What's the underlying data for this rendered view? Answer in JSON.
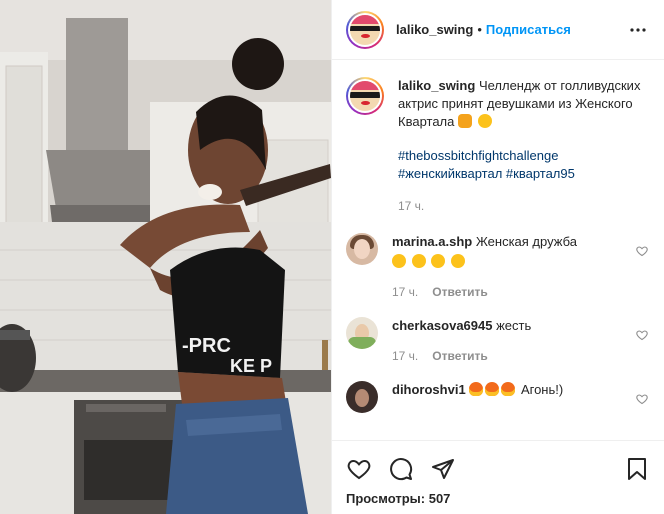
{
  "post": {
    "author": "laliko_swing",
    "separator": "•",
    "follow_label": "Подписаться",
    "more_icon": "more-horizontal-icon"
  },
  "caption": {
    "author": "laliko_swing",
    "text": "Челлендж от голливудских актрис принят девушками из Женского Квартала",
    "hashtags": [
      "#thebossbitchfightchallenge",
      "#женскийквартал",
      "#квартал95"
    ],
    "time": "17 ч."
  },
  "comments": [
    {
      "user": "marina.a.shp",
      "text": "Женская дружба",
      "time": "17 ч.",
      "reply_label": "Ответить"
    },
    {
      "user": "cherkasova6945",
      "text": "жесть",
      "time": "17 ч.",
      "reply_label": "Ответить"
    },
    {
      "user": "dihoroshvi1",
      "text": "Агонь!)",
      "time": "",
      "reply_label": ""
    }
  ],
  "actions": {
    "views_label": "Просмотры:",
    "views_count": "507"
  },
  "colors": {
    "accent": "#0095f6",
    "hashtag": "#00376b",
    "muted": "#8e8e8e",
    "text": "#262626"
  }
}
